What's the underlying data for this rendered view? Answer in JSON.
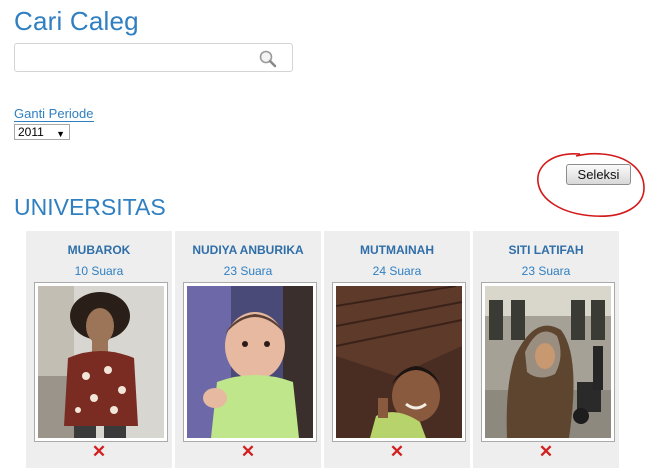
{
  "page": {
    "title": "Cari Caleg"
  },
  "search": {
    "value": "",
    "placeholder": ""
  },
  "period": {
    "label": "Ganti Periode",
    "selected": "2011"
  },
  "actions": {
    "select_label": "Seleksi"
  },
  "section": {
    "title": "UNIVERSITAS"
  },
  "candidates": [
    {
      "name": "MUBAROK",
      "votes": "10 Suara",
      "remove": "✕"
    },
    {
      "name": "NUDIYA ANBURIKA",
      "votes": "23 Suara",
      "remove": "✕"
    },
    {
      "name": "MUTMAINAH",
      "votes": "24 Suara",
      "remove": "✕"
    },
    {
      "name": "SITI LATIFAH",
      "votes": "23 Suara",
      "remove": "✕"
    }
  ],
  "colors": {
    "accent": "#2f7fc1",
    "remove": "#d02020",
    "annotation": "#d21a1a"
  },
  "icons": {
    "search": "search-icon",
    "dropdown": "chevron-down-icon",
    "remove": "close-icon"
  }
}
